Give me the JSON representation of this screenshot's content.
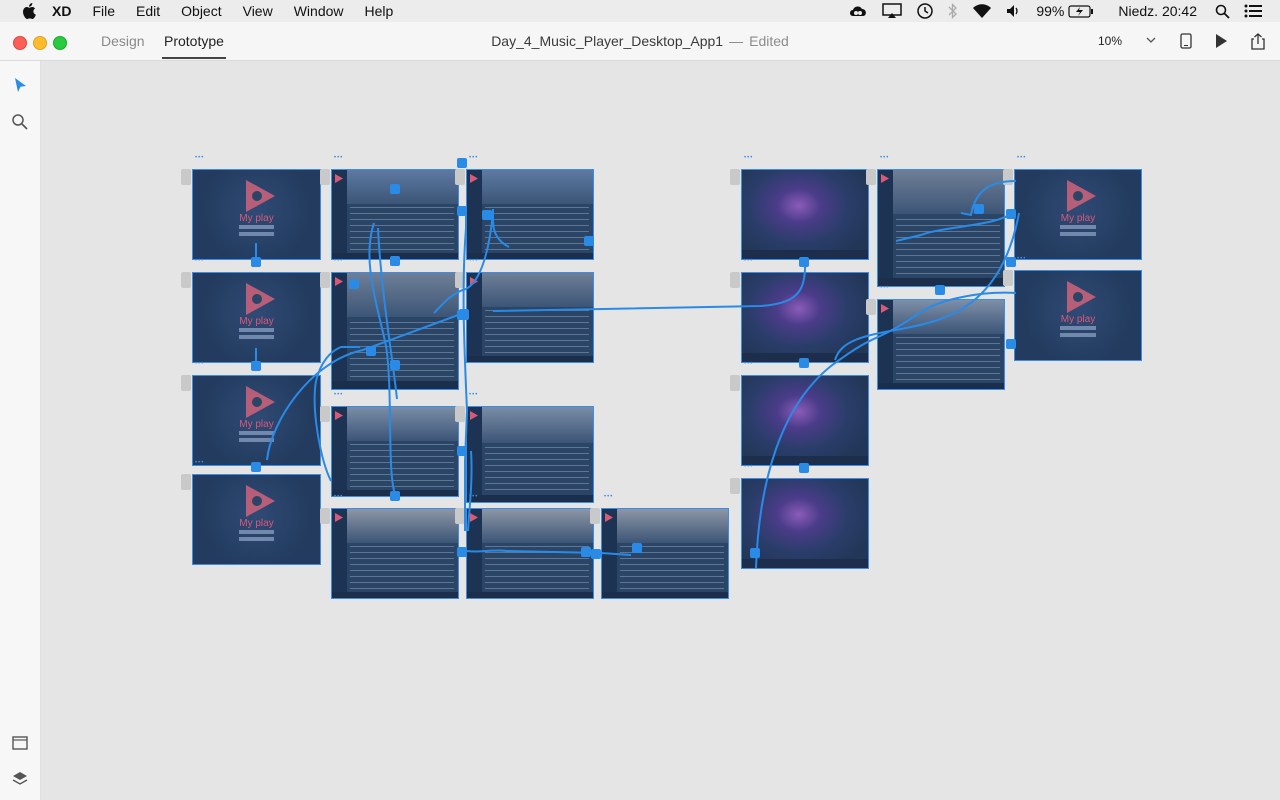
{
  "menubar": {
    "app_name": "XD",
    "items": [
      "File",
      "Edit",
      "Object",
      "View",
      "Window",
      "Help"
    ],
    "battery": "99%",
    "clock": "Niedz. 20:42"
  },
  "titlebar": {
    "tabs": [
      "Design",
      "Prototype"
    ],
    "active_tab": "Prototype",
    "document_name": "Day_4_Music_Player_Desktop_App1",
    "separator": "—",
    "status": "Edited",
    "zoom": "10%"
  },
  "artboard_text": {
    "intro_title": "My play"
  },
  "colors": {
    "accent": "#2a8be6",
    "brand_pink": "#d85a77"
  },
  "icons": [
    "apple-icon",
    "creative-cloud-icon",
    "airplay-icon",
    "time-machine-icon",
    "bluetooth-icon",
    "wifi-icon",
    "volume-icon",
    "battery-icon",
    "spotlight-icon",
    "notification-center-icon",
    "select-tool-icon",
    "zoom-tool-icon",
    "device-preview-icon",
    "play-preview-icon",
    "share-icon",
    "artboard-tool-icon",
    "layers-icon"
  ]
}
